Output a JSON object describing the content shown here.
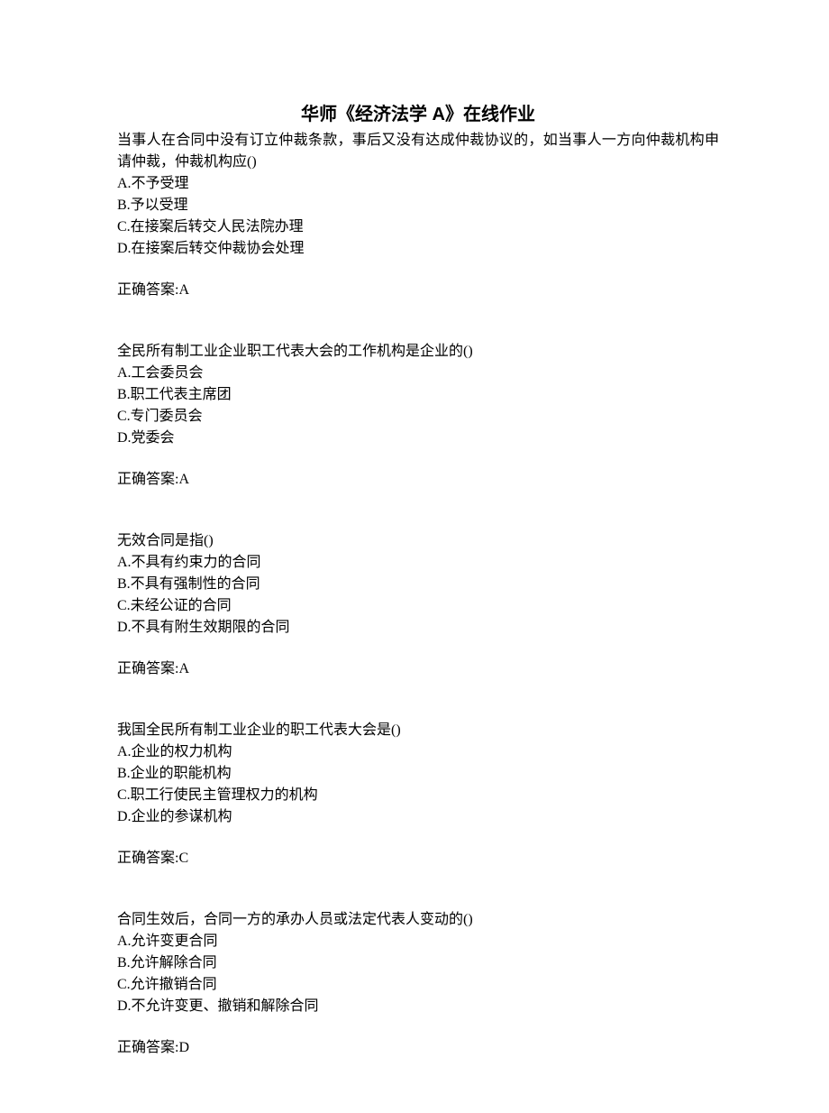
{
  "title": "华师《经济法学 A》在线作业",
  "questions": [
    {
      "text": "当事人在合同中没有订立仲裁条款，事后又没有达成仲裁协议的，如当事人一方向仲裁机构申请仲裁，仲裁机构应()",
      "options": [
        "A.不予受理",
        "B.予以受理",
        "C.在接案后转交人民法院办理",
        "D.在接案后转交仲裁协会处理"
      ],
      "answer": "正确答案:A"
    },
    {
      "text": "全民所有制工业企业职工代表大会的工作机构是企业的()",
      "options": [
        "A.工会委员会",
        "B.职工代表主席团",
        "C.专门委员会",
        "D.党委会"
      ],
      "answer": "正确答案:A"
    },
    {
      "text": "无效合同是指()",
      "options": [
        "A.不具有约束力的合同",
        "B.不具有强制性的合同",
        "C.未经公证的合同",
        "D.不具有附生效期限的合同"
      ],
      "answer": "正确答案:A"
    },
    {
      "text": "我国全民所有制工业企业的职工代表大会是()",
      "options": [
        "A.企业的权力机构",
        "B.企业的职能机构",
        "C.职工行使民主管理权力的机构",
        "D.企业的参谋机构"
      ],
      "answer": "正确答案:C"
    },
    {
      "text": "合同生效后，合同一方的承办人员或法定代表人变动的()",
      "options": [
        "A.允许变更合同",
        "B.允许解除合同",
        "C.允许撤销合同",
        "D.不允许变更、撤销和解除合同"
      ],
      "answer": "正确答案:D"
    }
  ]
}
